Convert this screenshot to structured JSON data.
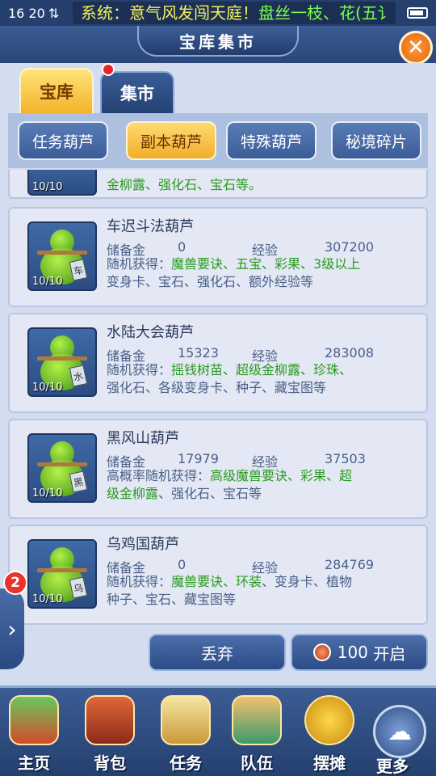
{
  "status": {
    "time": "16 20",
    "network": "⇅",
    "marquee_system": "系统：意气风发闯天庭！",
    "marquee_message": "盘丝一枝、花(五讠"
  },
  "header": {
    "title": "宝库集市",
    "close_symbol": "✕"
  },
  "tabs": [
    {
      "label": "宝库",
      "active": true
    },
    {
      "label": "集市",
      "active": false
    }
  ],
  "subtabs": [
    {
      "label": "任务葫芦",
      "active": false
    },
    {
      "label": "副本葫芦",
      "active": true
    },
    {
      "label": "特殊葫芦",
      "active": false
    },
    {
      "label": "秘境碎片",
      "active": false
    }
  ],
  "partial_card": {
    "count": "10/10",
    "drops_tail": "金柳露、强化石、宝石等。"
  },
  "labels": {
    "reserve": "储备金",
    "exp": "经验",
    "random_drop": "随机获得：",
    "high_prob": "高概率"
  },
  "items": [
    {
      "name": "车迟斗法葫芦",
      "count": "10/10",
      "tag": "车",
      "reserve": "0",
      "exp": "307200",
      "drops_prefix": "随机获得：",
      "drops_green": "魔兽要诀、五宝、彩果、3级以上",
      "drops_plain": "变身卡、宝石、强化石、额外经验等"
    },
    {
      "name": "水陆大会葫芦",
      "count": "10/10",
      "tag": "水",
      "reserve": "15323",
      "exp": "283008",
      "drops_prefix": "随机获得：",
      "drops_green": "摇钱树苗、超级金柳露、珍珠、",
      "drops_plain": "强化石、各级变身卡、种子、藏宝图等"
    },
    {
      "name": "黑风山葫芦",
      "count": "10/10",
      "tag": "黑",
      "reserve": "17979",
      "exp": "37503",
      "drops_prefix": "高概率随机获得：",
      "drops_green": "高级魔兽要诀、彩果、超",
      "drops_plain_green": "级金柳露",
      "drops_plain": "、强化石、宝石等"
    },
    {
      "name": "乌鸡国葫芦",
      "count": "10/10",
      "tag": "乌",
      "reserve": "0",
      "exp": "284769",
      "drops_prefix": "随机获得：",
      "drops_green": "魔兽要诀、环装",
      "drops_mid": "、变身卡、植物",
      "drops_plain": "种子、宝石、藏宝图等"
    }
  ],
  "actions": {
    "discard": "丢弃",
    "open_cost": "100",
    "open": "开启"
  },
  "side": {
    "badge": "2",
    "arrow": "›"
  },
  "nav": [
    {
      "label": "主页"
    },
    {
      "label": "背包"
    },
    {
      "label": "任务"
    },
    {
      "label": "队伍"
    },
    {
      "label": "摆摊"
    },
    {
      "label": "更多"
    }
  ],
  "colors": {
    "accent_gold": "#f3b32b",
    "primary_blue": "#2b4679",
    "drop_green": "#2a9a1e",
    "close_orange": "#e06a0c"
  }
}
